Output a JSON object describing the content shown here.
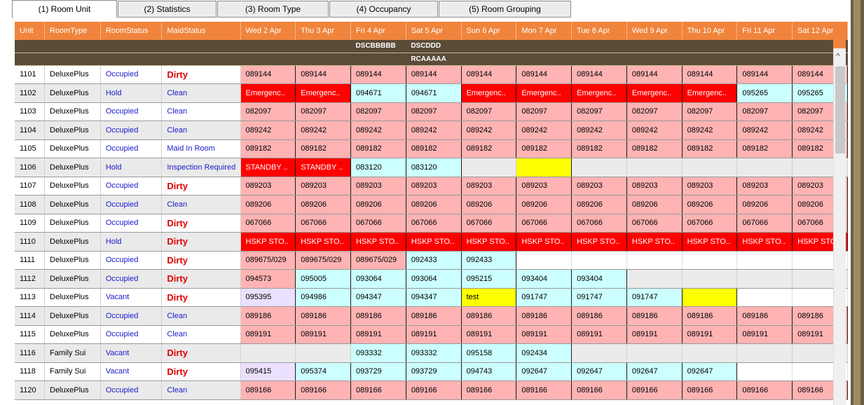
{
  "tabs": [
    {
      "label": "(1) Room Unit",
      "active": true
    },
    {
      "label": "(2) Statistics",
      "active": false
    },
    {
      "label": "(3) Room Type",
      "active": false
    },
    {
      "label": "(4) Occupancy",
      "active": false
    },
    {
      "label": "(5) Room Grouping",
      "active": false
    }
  ],
  "columns": {
    "unit": "Unit",
    "roomtype": "RoomType",
    "roomstatus": "RoomStatus",
    "maidstatus": "MaidStatus",
    "dates": [
      "Wed 2 Apr",
      "Thu 3 Apr",
      "Fri 4 Apr",
      "Sat 5 Apr",
      "Sun 6 Apr",
      "Mon 7 Apr",
      "Tue 8 Apr",
      "Wed 9 Apr",
      "Thu 10 Apr",
      "Fri 11 Apr",
      "Sat 12 Apr"
    ]
  },
  "bands": [
    {
      "labels": [
        "DSCBBBBB",
        "DSCDDD"
      ]
    },
    {
      "labels": [
        "RCAAAAA"
      ]
    }
  ],
  "colors": {
    "pink": "#ffb3b3",
    "cyan": "#ccffff",
    "red": "#ff0000",
    "yellow": "#ffff00",
    "lavender": "#ece0ff",
    "header": "#f0843c",
    "band": "#5a4c37",
    "dirty": "#e00000",
    "status_text": "#1a1acc"
  },
  "rows": [
    {
      "unit": "1101",
      "type": "DeluxePlus",
      "status": "Occupied",
      "maid": "Dirty",
      "cells": [
        [
          "089144",
          "pink"
        ],
        [
          "089144",
          "pink"
        ],
        [
          "089144",
          "pink"
        ],
        [
          "089144",
          "pink"
        ],
        [
          "089144",
          "pink"
        ],
        [
          "089144",
          "pink"
        ],
        [
          "089144",
          "pink"
        ],
        [
          "089144",
          "pink"
        ],
        [
          "089144",
          "pink"
        ],
        [
          "089144",
          "pink"
        ],
        [
          "089144",
          "pink"
        ]
      ]
    },
    {
      "unit": "1102",
      "type": "DeluxePlus",
      "status": "Hold",
      "maid": "Clean",
      "cells": [
        [
          "Emergenc..",
          "red"
        ],
        [
          "Emergenc..",
          "red"
        ],
        [
          "094671",
          "cyan"
        ],
        [
          "094671",
          "cyan"
        ],
        [
          "Emergenc..",
          "red"
        ],
        [
          "Emergenc..",
          "red"
        ],
        [
          "Emergenc..",
          "red"
        ],
        [
          "Emergenc..",
          "red"
        ],
        [
          "Emergenc..",
          "red"
        ],
        [
          "095265",
          "cyan"
        ],
        [
          "095265",
          "cyan"
        ]
      ]
    },
    {
      "unit": "1103",
      "type": "DeluxePlus",
      "status": "Occupied",
      "maid": "Clean",
      "cells": [
        [
          "082097",
          "pink"
        ],
        [
          "082097",
          "pink"
        ],
        [
          "082097",
          "pink"
        ],
        [
          "082097",
          "pink"
        ],
        [
          "082097",
          "pink"
        ],
        [
          "082097",
          "pink"
        ],
        [
          "082097",
          "pink"
        ],
        [
          "082097",
          "pink"
        ],
        [
          "082097",
          "pink"
        ],
        [
          "082097",
          "pink"
        ],
        [
          "082097",
          "pink"
        ]
      ]
    },
    {
      "unit": "1104",
      "type": "DeluxePlus",
      "status": "Occupied",
      "maid": "Clean",
      "cells": [
        [
          "089242",
          "pink"
        ],
        [
          "089242",
          "pink"
        ],
        [
          "089242",
          "pink"
        ],
        [
          "089242",
          "pink"
        ],
        [
          "089242",
          "pink"
        ],
        [
          "089242",
          "pink"
        ],
        [
          "089242",
          "pink"
        ],
        [
          "089242",
          "pink"
        ],
        [
          "089242",
          "pink"
        ],
        [
          "089242",
          "pink"
        ],
        [
          "089242",
          "pink"
        ]
      ]
    },
    {
      "unit": "1105",
      "type": "DeluxePlus",
      "status": "Occupied",
      "maid": "Maid In Room",
      "cells": [
        [
          "089182",
          "pink"
        ],
        [
          "089182",
          "pink"
        ],
        [
          "089182",
          "pink"
        ],
        [
          "089182",
          "pink"
        ],
        [
          "089182",
          "pink"
        ],
        [
          "089182",
          "pink"
        ],
        [
          "089182",
          "pink"
        ],
        [
          "089182",
          "pink"
        ],
        [
          "089182",
          "pink"
        ],
        [
          "089182",
          "pink"
        ],
        [
          "089182",
          "pink"
        ]
      ]
    },
    {
      "unit": "1106",
      "type": "DeluxePlus",
      "status": "Hold",
      "maid": "Inspection Required",
      "cells": [
        [
          "STANDBY ..",
          "red"
        ],
        [
          "STANDBY ..",
          "red"
        ],
        [
          "083120",
          "cyan"
        ],
        [
          "083120",
          "cyan"
        ],
        [
          "",
          "empty"
        ],
        [
          "",
          "yellow"
        ],
        [
          "",
          "empty"
        ],
        [
          "",
          "empty"
        ],
        [
          "",
          "empty"
        ],
        [
          "",
          "empty"
        ],
        [
          "",
          "empty"
        ]
      ]
    },
    {
      "unit": "1107",
      "type": "DeluxePlus",
      "status": "Occupied",
      "maid": "Dirty",
      "cells": [
        [
          "089203",
          "pink"
        ],
        [
          "089203",
          "pink"
        ],
        [
          "089203",
          "pink"
        ],
        [
          "089203",
          "pink"
        ],
        [
          "089203",
          "pink"
        ],
        [
          "089203",
          "pink"
        ],
        [
          "089203",
          "pink"
        ],
        [
          "089203",
          "pink"
        ],
        [
          "089203",
          "pink"
        ],
        [
          "089203",
          "pink"
        ],
        [
          "089203",
          "pink"
        ]
      ]
    },
    {
      "unit": "1108",
      "type": "DeluxePlus",
      "status": "Occupied",
      "maid": "Clean",
      "cells": [
        [
          "089206",
          "pink"
        ],
        [
          "089206",
          "pink"
        ],
        [
          "089206",
          "pink"
        ],
        [
          "089206",
          "pink"
        ],
        [
          "089206",
          "pink"
        ],
        [
          "089206",
          "pink"
        ],
        [
          "089206",
          "pink"
        ],
        [
          "089206",
          "pink"
        ],
        [
          "089206",
          "pink"
        ],
        [
          "089206",
          "pink"
        ],
        [
          "089206",
          "pink"
        ]
      ]
    },
    {
      "unit": "1109",
      "type": "DeluxePlus",
      "status": "Occupied",
      "maid": "Dirty",
      "cells": [
        [
          "067066",
          "pink"
        ],
        [
          "067066",
          "pink"
        ],
        [
          "067066",
          "pink"
        ],
        [
          "067066",
          "pink"
        ],
        [
          "067066",
          "pink"
        ],
        [
          "067066",
          "pink"
        ],
        [
          "067066",
          "pink"
        ],
        [
          "067066",
          "pink"
        ],
        [
          "067066",
          "pink"
        ],
        [
          "067066",
          "pink"
        ],
        [
          "067066",
          "pink"
        ]
      ]
    },
    {
      "unit": "1110",
      "type": "DeluxePlus",
      "status": "Hold",
      "maid": "Dirty",
      "cells": [
        [
          "HSKP STO..",
          "red"
        ],
        [
          "HSKP STO..",
          "red"
        ],
        [
          "HSKP STO..",
          "red"
        ],
        [
          "HSKP STO..",
          "red"
        ],
        [
          "HSKP STO..",
          "red"
        ],
        [
          "HSKP STO..",
          "red"
        ],
        [
          "HSKP STO..",
          "red"
        ],
        [
          "HSKP STO..",
          "red"
        ],
        [
          "HSKP STO..",
          "red"
        ],
        [
          "HSKP STO..",
          "red"
        ],
        [
          "HSKP STO..",
          "red"
        ]
      ]
    },
    {
      "unit": "1111",
      "type": "DeluxePlus",
      "status": "Occupied",
      "maid": "Dirty",
      "cells": [
        [
          "089675/029",
          "pink"
        ],
        [
          "089675/029",
          "pink"
        ],
        [
          "089675/029",
          "pink"
        ],
        [
          "092433",
          "cyan"
        ],
        [
          "092433",
          "cyan"
        ],
        [
          "",
          "emptyw"
        ],
        [
          "",
          "emptyw"
        ],
        [
          "",
          "emptyw"
        ],
        [
          "",
          "emptyw"
        ],
        [
          "",
          "emptyw"
        ],
        [
          "",
          "emptyw"
        ]
      ]
    },
    {
      "unit": "1112",
      "type": "DeluxePlus",
      "status": "Occupied",
      "maid": "Dirty",
      "cells": [
        [
          "094573",
          "pink"
        ],
        [
          "095005",
          "cyan"
        ],
        [
          "093064",
          "cyan"
        ],
        [
          "093064",
          "cyan"
        ],
        [
          "095215",
          "cyan"
        ],
        [
          "093404",
          "cyan"
        ],
        [
          "093404",
          "cyan"
        ],
        [
          "",
          "empty"
        ],
        [
          "",
          "empty"
        ],
        [
          "",
          "empty"
        ],
        [
          "",
          "empty"
        ]
      ]
    },
    {
      "unit": "1113",
      "type": "DeluxePlus",
      "status": "Vacant",
      "maid": "Dirty",
      "cells": [
        [
          "095395",
          "lav"
        ],
        [
          "094986",
          "cyan"
        ],
        [
          "094347",
          "cyan"
        ],
        [
          "094347",
          "cyan"
        ],
        [
          "test",
          "yellow"
        ],
        [
          "091747",
          "cyan"
        ],
        [
          "091747",
          "cyan"
        ],
        [
          "091747",
          "cyan"
        ],
        [
          "",
          "yellow"
        ],
        [
          "",
          "emptyw"
        ],
        [
          "",
          "emptyw"
        ]
      ]
    },
    {
      "unit": "1114",
      "type": "DeluxePlus",
      "status": "Occupied",
      "maid": "Clean",
      "cells": [
        [
          "089186",
          "pink"
        ],
        [
          "089186",
          "pink"
        ],
        [
          "089186",
          "pink"
        ],
        [
          "089186",
          "pink"
        ],
        [
          "089186",
          "pink"
        ],
        [
          "089186",
          "pink"
        ],
        [
          "089186",
          "pink"
        ],
        [
          "089186",
          "pink"
        ],
        [
          "089186",
          "pink"
        ],
        [
          "089186",
          "pink"
        ],
        [
          "089186",
          "pink"
        ]
      ]
    },
    {
      "unit": "1115",
      "type": "DeluxePlus",
      "status": "Occupied",
      "maid": "Clean",
      "cells": [
        [
          "089191",
          "pink"
        ],
        [
          "089191",
          "pink"
        ],
        [
          "089191",
          "pink"
        ],
        [
          "089191",
          "pink"
        ],
        [
          "089191",
          "pink"
        ],
        [
          "089191",
          "pink"
        ],
        [
          "089191",
          "pink"
        ],
        [
          "089191",
          "pink"
        ],
        [
          "089191",
          "pink"
        ],
        [
          "089191",
          "pink"
        ],
        [
          "089191",
          "pink"
        ]
      ]
    },
    {
      "unit": "1116",
      "type": "Family Sui",
      "status": "Vacant",
      "maid": "Dirty",
      "cells": [
        [
          "",
          "empty"
        ],
        [
          "",
          "empty"
        ],
        [
          "093332",
          "cyan"
        ],
        [
          "093332",
          "cyan"
        ],
        [
          "095158",
          "cyan"
        ],
        [
          "092434",
          "cyan"
        ],
        [
          "",
          "empty"
        ],
        [
          "",
          "empty"
        ],
        [
          "",
          "empty"
        ],
        [
          "",
          "empty"
        ],
        [
          "",
          "empty"
        ]
      ]
    },
    {
      "unit": "1118",
      "type": "Family Sui",
      "status": "Vacant",
      "maid": "Dirty",
      "cells": [
        [
          "095415",
          "lav"
        ],
        [
          "095374",
          "cyan"
        ],
        [
          "093729",
          "cyan"
        ],
        [
          "093729",
          "cyan"
        ],
        [
          "094743",
          "cyan"
        ],
        [
          "092647",
          "cyan"
        ],
        [
          "092647",
          "cyan"
        ],
        [
          "092647",
          "cyan"
        ],
        [
          "092647",
          "cyan"
        ],
        [
          "",
          "emptyw"
        ],
        [
          "",
          "emptyw"
        ]
      ]
    },
    {
      "unit": "1120",
      "type": "DeluxePlus",
      "status": "Occupied",
      "maid": "Clean",
      "cells": [
        [
          "089166",
          "pink"
        ],
        [
          "089166",
          "pink"
        ],
        [
          "089166",
          "pink"
        ],
        [
          "089166",
          "pink"
        ],
        [
          "089166",
          "pink"
        ],
        [
          "089166",
          "pink"
        ],
        [
          "089166",
          "pink"
        ],
        [
          "089166",
          "pink"
        ],
        [
          "089166",
          "pink"
        ],
        [
          "089166",
          "pink"
        ],
        [
          "089166",
          "pink"
        ]
      ]
    }
  ]
}
